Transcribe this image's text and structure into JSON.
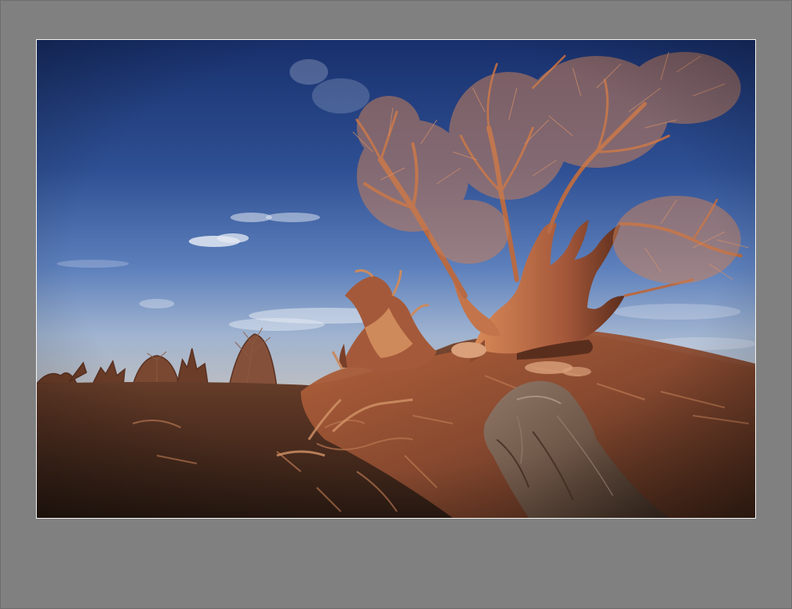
{
  "frame": {
    "background_color": "#808080",
    "border_color": "#f2f2f2"
  },
  "photo": {
    "subject": "desert-landscape-with-gnarled-dead-trees",
    "palette": {
      "sky_top": "#1b3470",
      "sky_mid": "#4f74b5",
      "sky_horizon": "#aab9cf",
      "tree_lit": "#c9774a",
      "tree_shadow": "#6a3420",
      "ground_lit": "#a35a3a",
      "ground_shadow": "#3b2418",
      "cloud": "#dfe6f2"
    }
  }
}
